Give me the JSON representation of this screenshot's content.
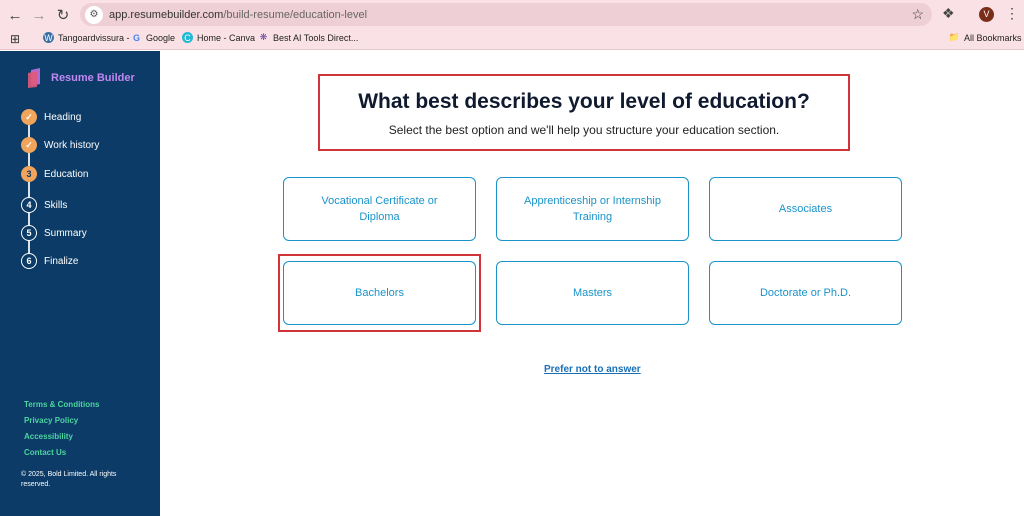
{
  "browser": {
    "url_host": "app.resumebuilder.com",
    "url_path": "/build-resume/education-level",
    "profile_initial": "V",
    "bookmarks": [
      {
        "label": "Tangoardvissura -"
      },
      {
        "label": "Google"
      },
      {
        "label": "Home - Canva"
      },
      {
        "label": "Best AI Tools Direct..."
      }
    ],
    "all_bookmarks": "All Bookmarks"
  },
  "sidebar": {
    "logo_text": "Resume Builder",
    "steps": [
      {
        "number": "1",
        "label": "Heading",
        "state": "done"
      },
      {
        "number": "2",
        "label": "Work history",
        "state": "done"
      },
      {
        "number": "3",
        "label": "Education",
        "state": "current"
      },
      {
        "number": "4",
        "label": "Skills",
        "state": "todo"
      },
      {
        "number": "5",
        "label": "Summary",
        "state": "todo"
      },
      {
        "number": "6",
        "label": "Finalize",
        "state": "todo"
      }
    ],
    "footer_links": [
      "Terms & Conditions",
      "Privacy Policy",
      "Accessibility",
      "Contact Us"
    ],
    "copyright": "© 2025, Bold Limited. All rights reserved."
  },
  "main": {
    "title": "What best describes your level of education?",
    "subtitle": "Select the best option and we'll help you structure your education section.",
    "options": [
      "Vocational Certificate or Diploma",
      "Apprenticeship or Internship Training",
      "Associates",
      "Bachelors",
      "Masters",
      "Doctorate or Ph.D."
    ],
    "prefer_not": "Prefer not to answer"
  },
  "colors": {
    "sidebar_bg": "#0b3b66",
    "accent": "#1a93c9",
    "step_done": "#f0a45c",
    "footer_link": "#4dd4a0",
    "highlight_box": "#d13438"
  }
}
